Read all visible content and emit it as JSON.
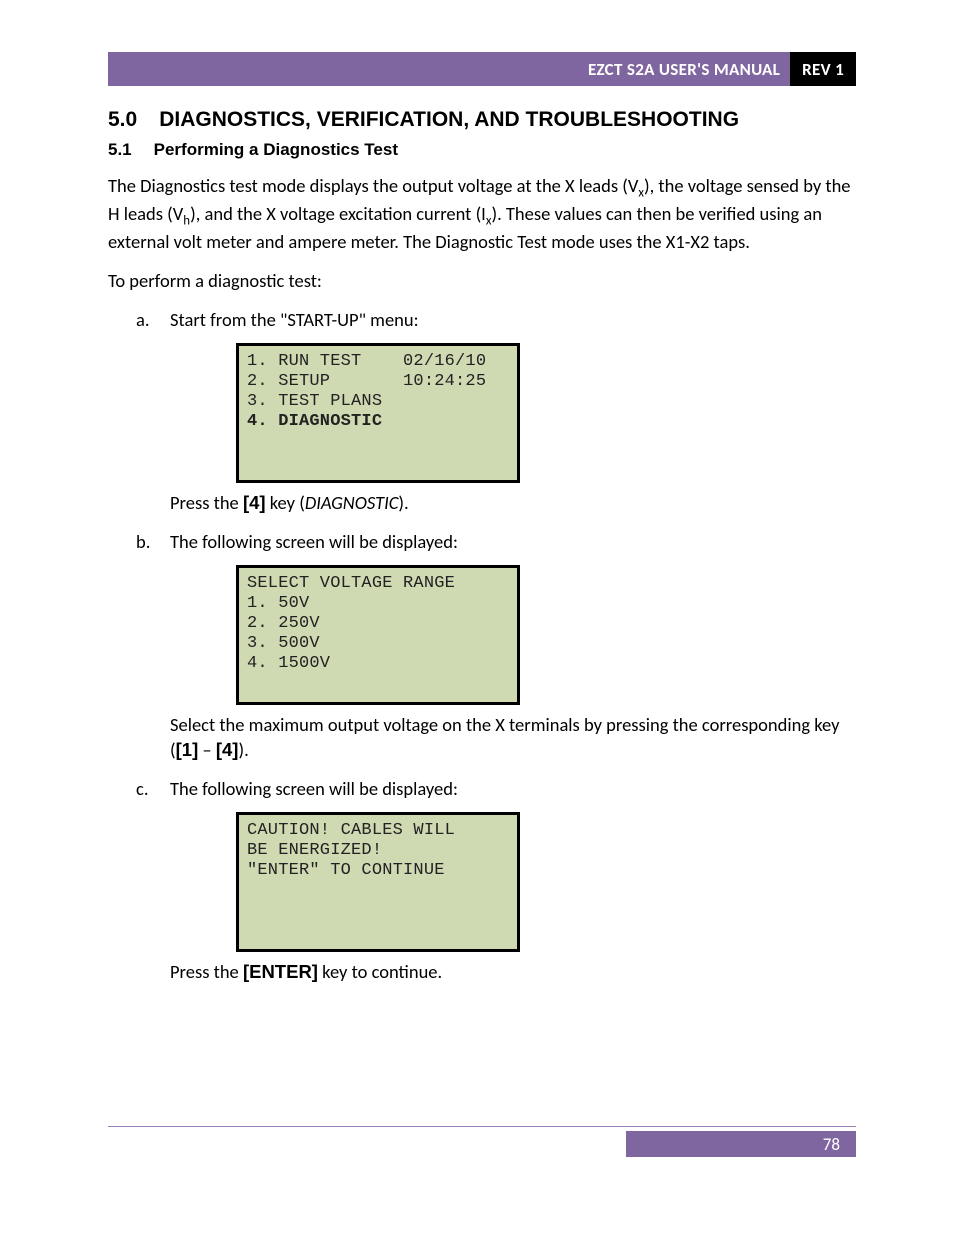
{
  "header": {
    "title": "EZCT S2A USER'S MANUAL",
    "rev": "REV 1"
  },
  "section": {
    "num": "5.0",
    "title": "DIAGNOSTICS, VERIFICATION, AND TROUBLESHOOTING"
  },
  "subsection": {
    "num": "5.1",
    "title": "Performing a Diagnostics Test"
  },
  "para_intro_a": "The Diagnostics test mode displays the output voltage at the X leads (V",
  "para_intro_b": "), the voltage sensed by the H leads (V",
  "para_intro_c": "), and the X voltage excitation current (I",
  "para_intro_d": "). These values can then be verified using an external volt meter and ampere meter. The Diagnostic Test mode uses the X1-X2 taps.",
  "sub_x": "x",
  "sub_h": "h",
  "para_toperform": "To perform a diagnostic test:",
  "steps": {
    "a": {
      "letter": "a.",
      "text": "Start from the \"START-UP\" menu:",
      "lcd": {
        "l1": "1. RUN TEST    02/16/10",
        "l2": "2. SETUP       10:24:25",
        "l3": "3. TEST PLANS",
        "l4": "4. DIAGNOSTIC"
      },
      "after_pre": "Press the ",
      "after_key": "[4]",
      "after_mid": " key (",
      "after_ital": "DIAGNOSTIC",
      "after_post": ")."
    },
    "b": {
      "letter": "b.",
      "text": "The following screen will be displayed:",
      "lcd": {
        "l1": "SELECT VOLTAGE RANGE",
        "l2": "1. 50V",
        "l3": "2. 250V",
        "l4": "3. 500V",
        "l5": "4. 1500V"
      },
      "after_pre": "Select the maximum output voltage on the X terminals by pressing the corresponding key (",
      "after_k1": "[1]",
      "after_dash": " – ",
      "after_k4": "[4]",
      "after_post": ")."
    },
    "c": {
      "letter": "c.",
      "text": "The following screen will be displayed:",
      "lcd": {
        "l1": "CAUTION! CABLES WILL",
        "l2": "BE ENERGIZED!",
        "l3": "",
        "l4": "\"ENTER\" TO CONTINUE"
      },
      "after_pre": "Press the ",
      "after_key": "[ENTER]",
      "after_post": " key to continue."
    }
  },
  "footer": {
    "page": "78"
  }
}
